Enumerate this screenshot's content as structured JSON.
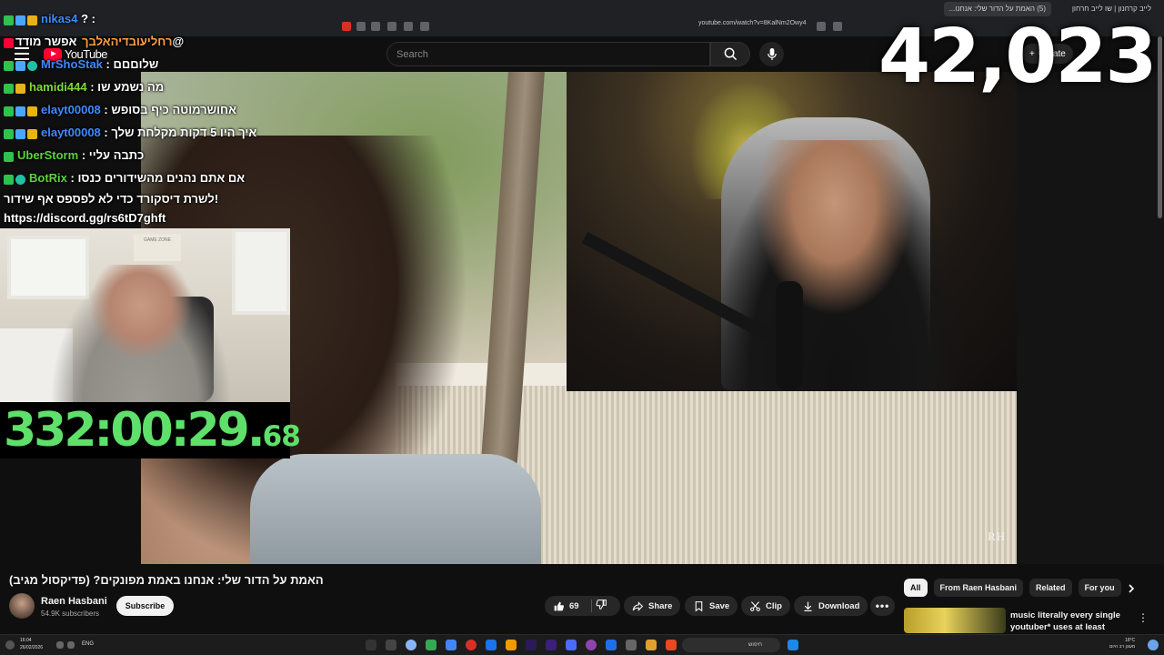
{
  "browser": {
    "active_tab_title": "(5) האמת על הדור שלי: אנחנו...",
    "other_tab_title": "לייב קרחנון | שו לייב חרחון",
    "url": "youtube.com/watch?v=8KalNm2Owy4"
  },
  "header": {
    "logo_text": "YouTube",
    "search_placeholder": "Search",
    "create_label": "Create"
  },
  "overlay": {
    "viewer_count": "42,023",
    "timer_main": "332:00:29.",
    "timer_fraction": "68",
    "video_watermark": "RH"
  },
  "chat": {
    "messages": [
      {
        "user": "nikas4",
        "text": "? :",
        "user_color": "blue",
        "badges": [
          "green",
          "blue",
          "gold"
        ]
      },
      {
        "user": "רחליעובדיהאלבך",
        "text": "אפשר מודד@",
        "user_color": "orange",
        "badges": [
          "red"
        ]
      },
      {
        "user": "MrShoStak",
        "text": ": שלוםםם",
        "user_color": "blue",
        "badges": [
          "green",
          "blue",
          "teal"
        ]
      },
      {
        "user": "hamidi444",
        "text": ": מה נשמע שו",
        "user_color": "lime",
        "badges": [
          "green",
          "gold"
        ]
      },
      {
        "user": "elayt00008",
        "text": ": אחושרמוטה כיף בסופש",
        "user_color": "blue",
        "badges": [
          "green",
          "blue",
          "gold"
        ]
      },
      {
        "user": "elayt00008",
        "text": ": איך היו 5 דקות מקלחת שלך",
        "user_color": "blue",
        "badges": [
          "green",
          "blue",
          "gold"
        ]
      },
      {
        "user": "UberStorm",
        "text": ": כתבה עליי",
        "user_color": "green",
        "badges": [
          "green"
        ]
      },
      {
        "user": "BotRix",
        "text": ": אם אתם נהנים מהשידורים כנסו",
        "user_color": "green",
        "badges": [
          "green",
          "teal"
        ]
      }
    ],
    "continuation_1": "לשרת דיסקורד כדי לא לפספס אף שידור!",
    "continuation_2": "https://discord.gg/rs6tD7ghft"
  },
  "cam_left": {
    "sign_text": "GAME ZONE"
  },
  "video": {
    "title": "האמת על הדור שלי: אנחנו באמת מפונקים? (פדיקסול מגיב)",
    "channel_name": "Raen Hasbani",
    "subscribers": "54.9K subscribers",
    "subscribe_label": "Subscribe",
    "like_count": "69",
    "share_label": "Share",
    "save_label": "Save",
    "clip_label": "Clip",
    "download_label": "Download"
  },
  "sidebar": {
    "filters": [
      "All",
      "From Raen Hasbani",
      "Related",
      "For you"
    ],
    "active_filter": "All",
    "recommendation_title": "music literally every single youtuber* uses at least once ..."
  },
  "taskbar": {
    "time": "16:04",
    "date": "26/02/2026",
    "language": "ENG",
    "search_text": "חיפוש",
    "weather_temp": "18°C",
    "weather_desc": "מעונן רב היום"
  },
  "colors": {
    "timer_green": "#5ee06a",
    "youtube_red": "#ff0033",
    "chat_blue": "#3d8bff",
    "chat_green": "#5bd33c"
  }
}
